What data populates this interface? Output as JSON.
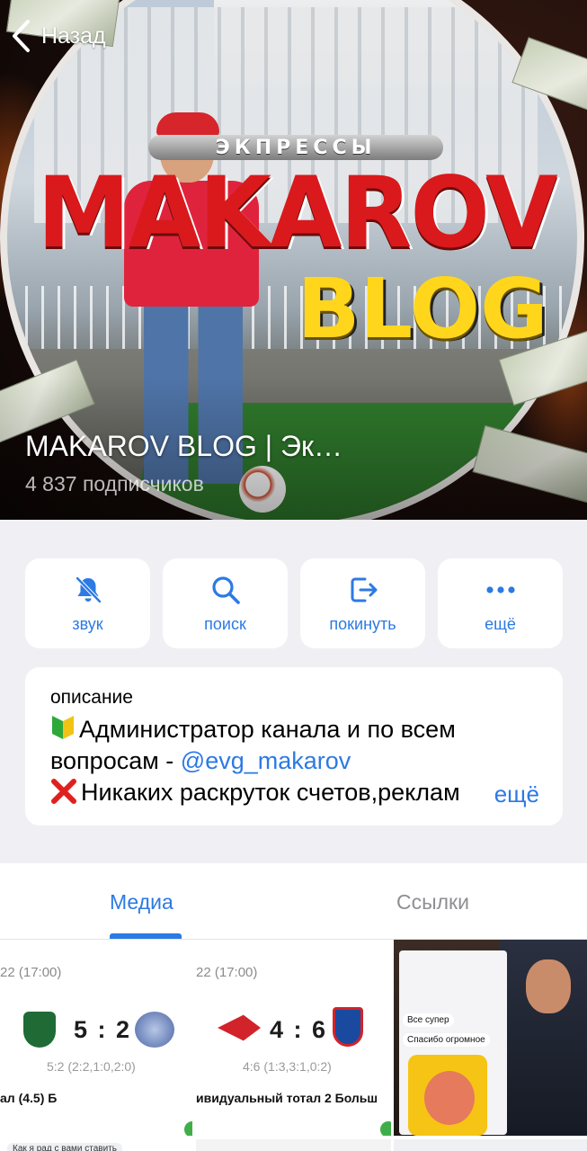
{
  "nav": {
    "back_label": "Назад"
  },
  "header": {
    "banner_small_text": "ЭКПРЕССЫ",
    "banner_brand_line1": "MAKAROV",
    "banner_brand_line2": "BLOG",
    "channel_title": "MAKAROV BLOG | Эк…",
    "subscribers": "4 837 подписчиков"
  },
  "actions": [
    {
      "label": "звук",
      "icon": "bell-slash-icon"
    },
    {
      "label": "поиск",
      "icon": "search-icon"
    },
    {
      "label": "покинуть",
      "icon": "leave-icon"
    },
    {
      "label": "ещё",
      "icon": "more-dots-icon"
    }
  ],
  "description": {
    "label": "описание",
    "line1": "Администратор канала и по всем",
    "line2_prefix": "вопросам - ",
    "line2_mention": "@evg_makarov",
    "line3": "Никаких раскруток счетов,реклам",
    "more": "ещё"
  },
  "tabs": {
    "media": "Медиа",
    "links": "Ссылки",
    "active": "media"
  },
  "media": [
    {
      "time": "22 (17:00)",
      "score": "5 : 2",
      "sub": "5:2 (2:2,1:0,2:0)",
      "bet": "ал (4.5) Б"
    },
    {
      "time": "22 (17:00)",
      "score": "4 : 6",
      "sub": "4:6 (1:3,3:1,0:2)",
      "bet": "ивидуальный тотал 2 Больш"
    },
    {
      "bubble1": "Все супер",
      "bubble2": "Спасибо огромное"
    }
  ],
  "media_row2": {
    "snippet": "Как я рад с вами ставить"
  },
  "colors": {
    "accent": "#2c7ae3",
    "background": "#f0f0f4",
    "card": "#ffffff"
  }
}
